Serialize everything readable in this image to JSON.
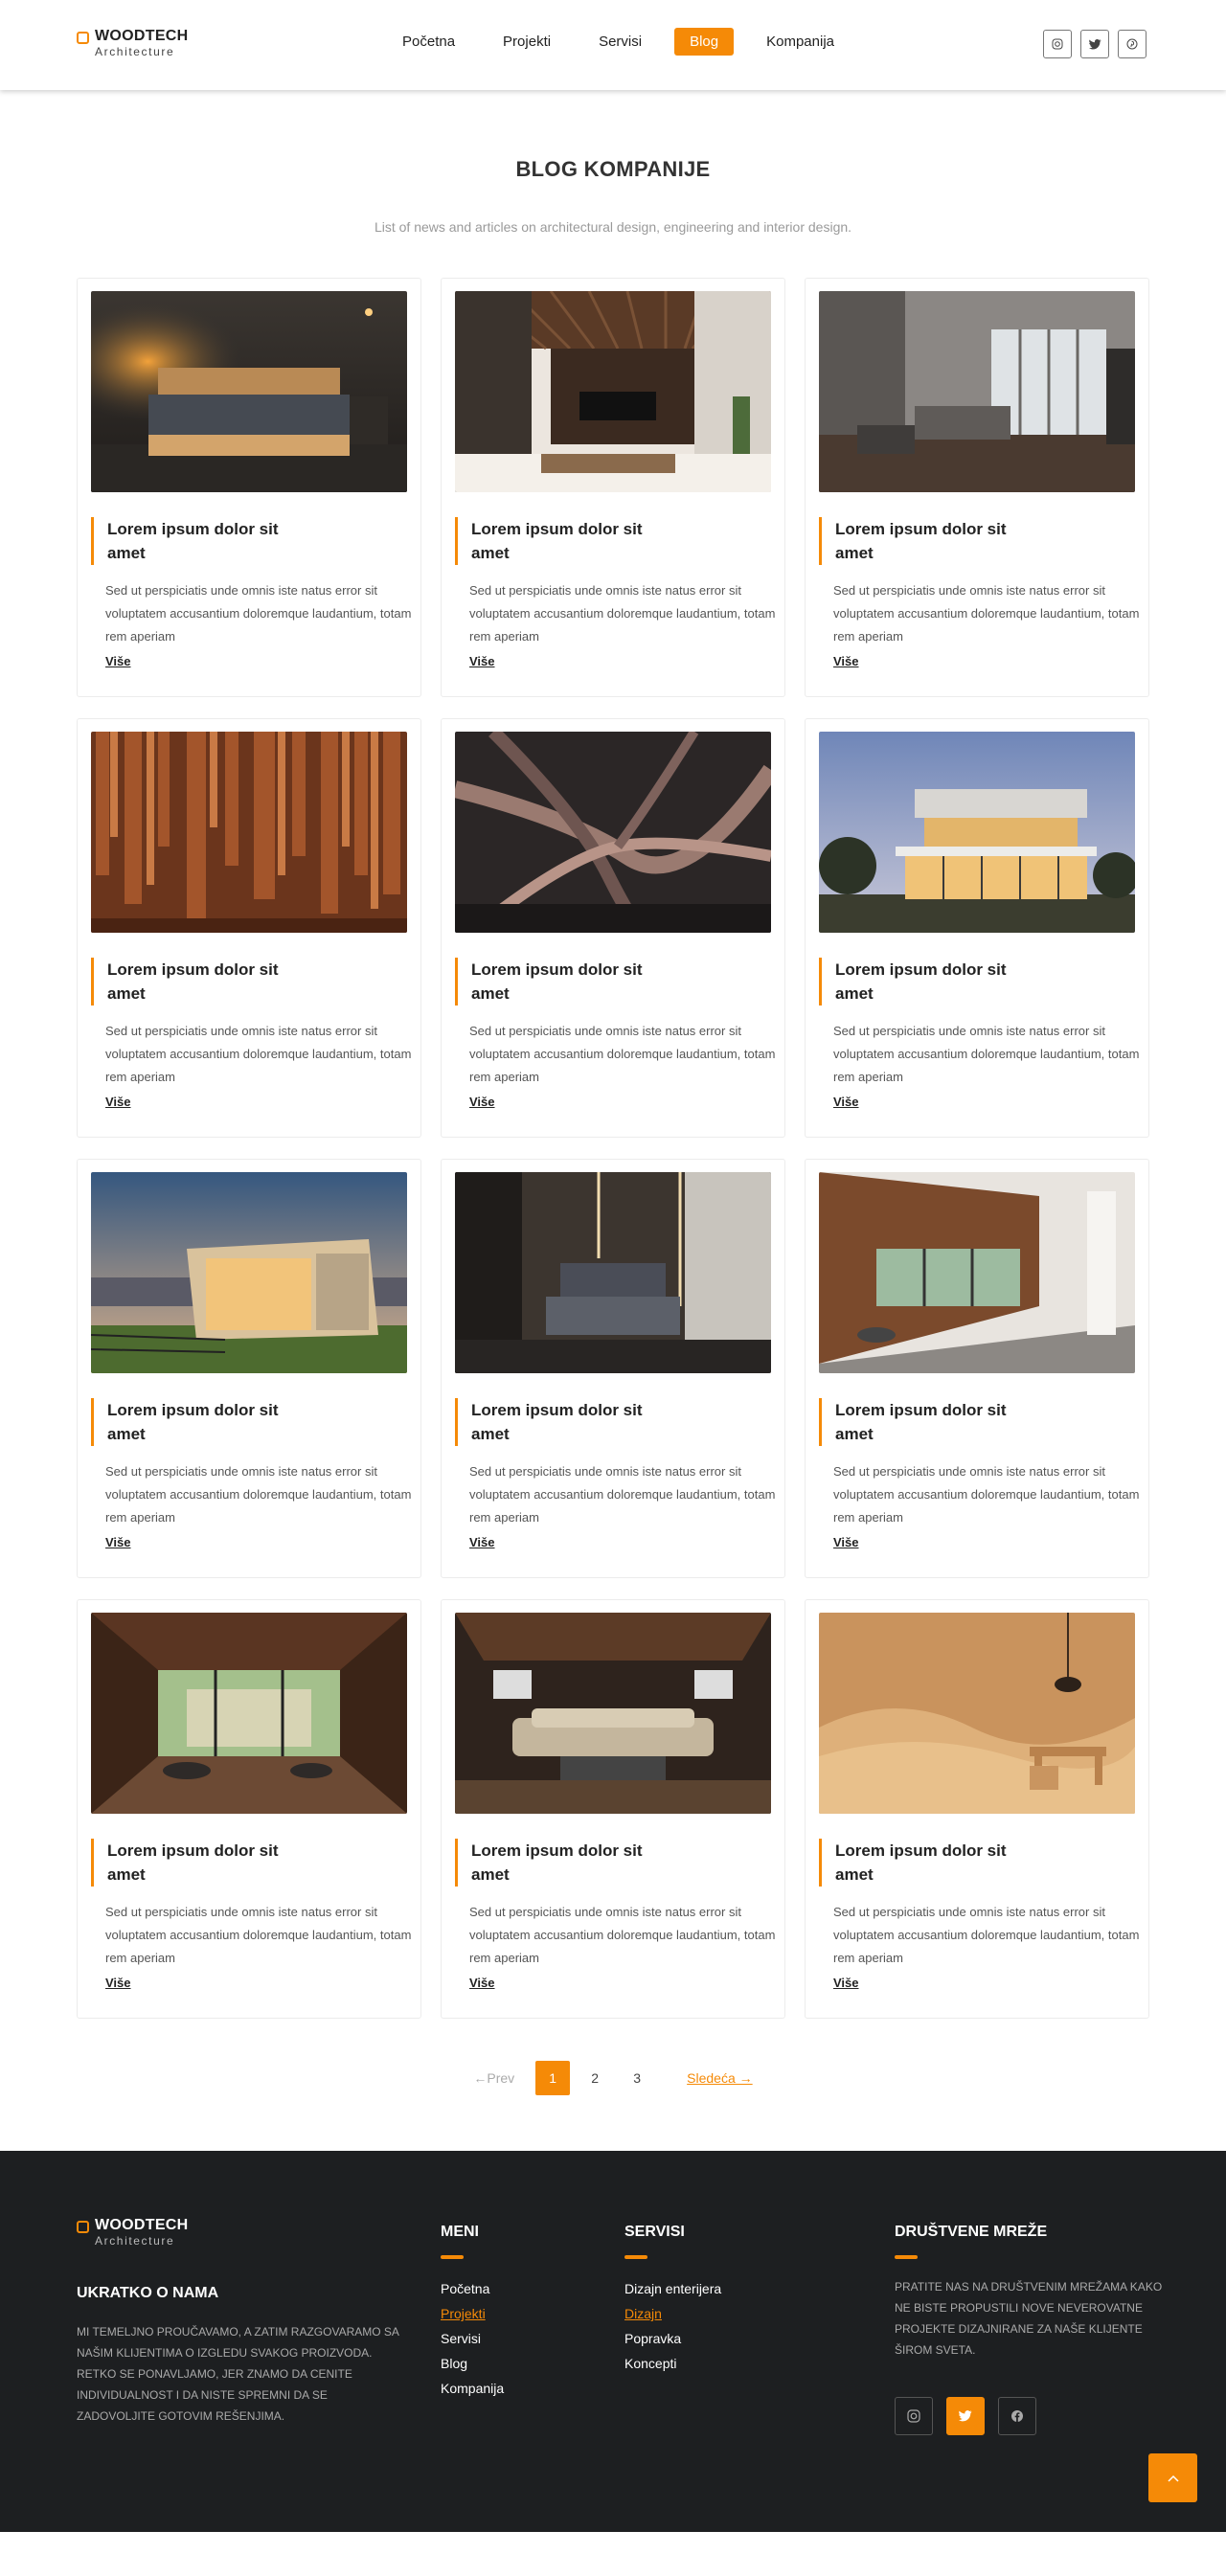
{
  "brand": {
    "name": "WOODTECH",
    "tagline": "Architecture"
  },
  "nav": [
    {
      "label": "Početna"
    },
    {
      "label": "Projekti"
    },
    {
      "label": "Servisi"
    },
    {
      "label": "Blog",
      "active": true
    },
    {
      "label": "Kompanija"
    }
  ],
  "social_icons": [
    "instagram-icon",
    "twitter-icon",
    "pinterest-icon"
  ],
  "hero": {
    "title": "BLOG KOMPANIJE",
    "subtitle": "List of  news and articles on architectural design, engineering and interior design."
  },
  "posts": [
    {
      "title": "Lorem ipsum dolor sit amet",
      "excerpt": "Sed ut perspiciatis unde omnis iste natus error sit voluptatem accusantium doloremque laudantium, totam rem aperiam",
      "more": "Više",
      "image": "dark bedroom with wooden bed"
    },
    {
      "title": "Lorem ipsum dolor sit amet",
      "excerpt": "Sed ut perspiciatis unde omnis iste natus error sit voluptatem accusantium doloremque laudantium, totam rem aperiam",
      "more": "Više",
      "image": "living room with wooden slat ceiling"
    },
    {
      "title": "Lorem ipsum dolor sit amet",
      "excerpt": "Sed ut perspiciatis unde omnis iste natus error sit voluptatem accusantium doloremque laudantium, totam rem aperiam",
      "more": "Više",
      "image": "modern grey living room"
    },
    {
      "title": "Lorem ipsum dolor sit amet",
      "excerpt": "Sed ut perspiciatis unde omnis iste natus error sit voluptatem accusantium doloremque laudantium, totam rem aperiam",
      "more": "Više",
      "image": "wooden column sculpture"
    },
    {
      "title": "Lorem ipsum dolor sit amet",
      "excerpt": "Sed ut perspiciatis unde omnis iste natus error sit voluptatem accusantium doloremque laudantium, totam rem aperiam",
      "more": "Više",
      "image": "abstract wooden installation"
    },
    {
      "title": "Lorem ipsum dolor sit amet",
      "excerpt": "Sed ut perspiciatis unde omnis iste natus error sit voluptatem accusantium doloremque laudantium, totam rem aperiam",
      "more": "Više",
      "image": "modern house at dusk"
    },
    {
      "title": "Lorem ipsum dolor sit amet",
      "excerpt": "Sed ut perspiciatis unde omnis iste natus error sit voluptatem accusantium doloremque laudantium, totam rem aperiam",
      "more": "Više",
      "image": "glass cabin at sunset"
    },
    {
      "title": "Lorem ipsum dolor sit amet",
      "excerpt": "Sed ut perspiciatis unde omnis iste natus error sit voluptatem accusantium doloremque laudantium, totam rem aperiam",
      "more": "Više",
      "image": "dark modern bedroom"
    },
    {
      "title": "Lorem ipsum dolor sit amet",
      "excerpt": "Sed ut perspiciatis unde omnis iste natus error sit voluptatem accusantium doloremque laudantium, totam rem aperiam",
      "more": "Više",
      "image": "wooden corridor with window"
    },
    {
      "title": "Lorem ipsum dolor sit amet",
      "excerpt": "Sed ut perspiciatis unde omnis iste natus error sit voluptatem accusantium doloremque laudantium, totam rem aperiam",
      "more": "Više",
      "image": "wooden room opening to garden"
    },
    {
      "title": "Lorem ipsum dolor sit amet",
      "excerpt": "Sed ut perspiciatis unde omnis iste natus error sit voluptatem accusantium doloremque laudantium, totam rem aperiam",
      "more": "Više",
      "image": "lounge with sectional sofa"
    },
    {
      "title": "Lorem ipsum dolor sit amet",
      "excerpt": "Sed ut perspiciatis unde omnis iste natus error sit voluptatem accusantium doloremque laudantium, totam rem aperiam",
      "more": "Više",
      "image": "curved light wood interior"
    }
  ],
  "pagination": {
    "prev": "←Prev",
    "pages": [
      "1",
      "2",
      "3"
    ],
    "current": "1",
    "next": "Sledeća →"
  },
  "footer": {
    "about_title": "UKRATKO O NAMA",
    "about_text": "Mi temeljno proučavamo, a zatim razgovaramo sa našim klijentima o izgledu svakog proizvoda. Retko se ponavljamo, jer znamo da cenite individualnost i da niste spremni da se zadovoljite gotovim rešenjima.",
    "menu_title": "MENI",
    "menu": [
      {
        "label": "Početna"
      },
      {
        "label": "Projekti",
        "active": true
      },
      {
        "label": "Servisi"
      },
      {
        "label": "Blog"
      },
      {
        "label": "Kompanija"
      }
    ],
    "services_title": "SERVISI",
    "services": [
      {
        "label": "Dizajn enterijera"
      },
      {
        "label": "Dizajn",
        "active": true
      },
      {
        "label": "Popravka"
      },
      {
        "label": "Koncepti"
      }
    ],
    "social_title": "DRUŠTVENE MREŽE",
    "social_text": "Pratite nas na društvenim mrežama kako ne biste propustili nove neverovatne projekte dizajnirane za naše klijente širom sveta.",
    "social_icons": [
      "instagram-icon",
      "twitter-icon",
      "facebook-icon"
    ],
    "back_to_top": "^"
  },
  "colors": {
    "accent": "#f58a07",
    "footer_bg": "#1d1f21",
    "text": "#222222"
  }
}
